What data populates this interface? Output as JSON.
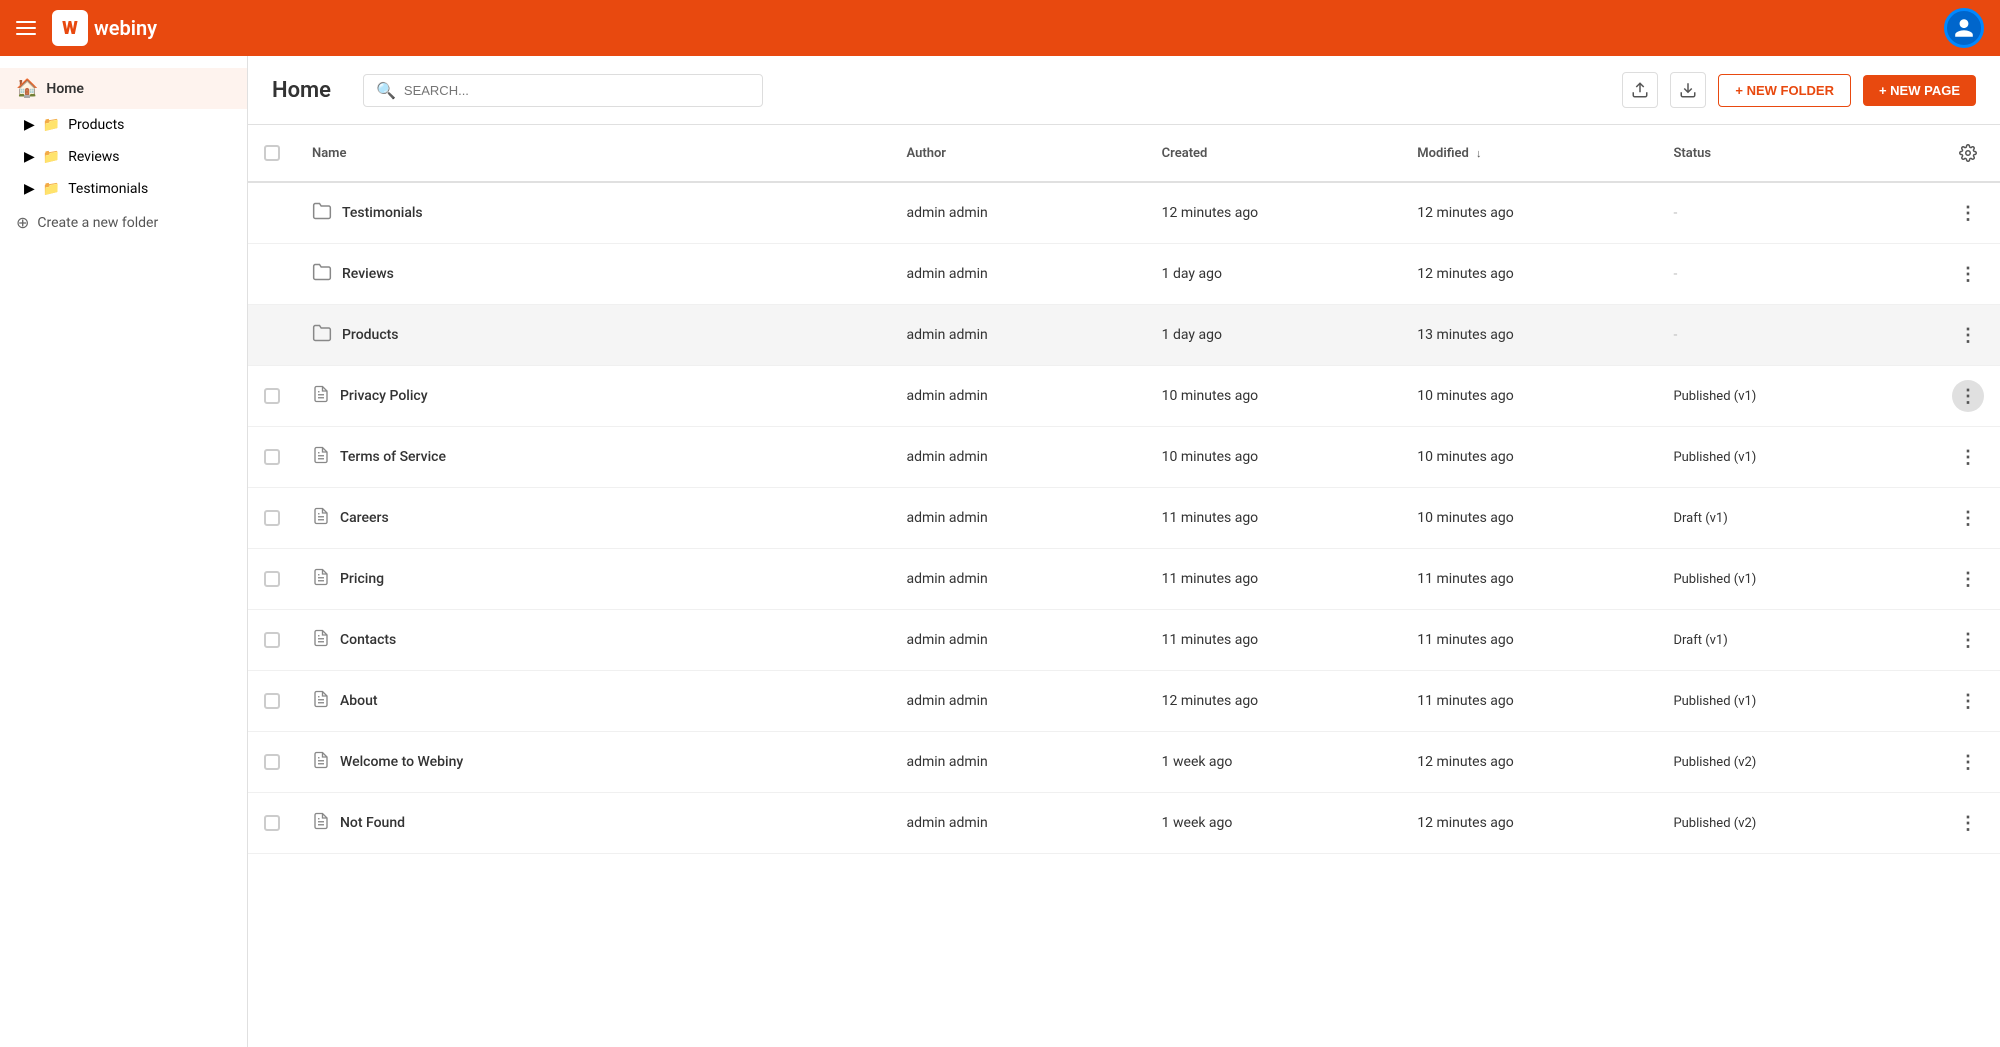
{
  "topNav": {
    "logoLetter": "W",
    "logoText": "webiny"
  },
  "sidebar": {
    "homeLabel": "Home",
    "items": [
      {
        "id": "products",
        "label": "Products",
        "type": "folder"
      },
      {
        "id": "reviews",
        "label": "Reviews",
        "type": "folder"
      },
      {
        "id": "testimonials",
        "label": "Testimonials",
        "type": "folder"
      }
    ],
    "createFolderLabel": "Create a new folder"
  },
  "pageHeader": {
    "title": "Home",
    "searchPlaceholder": "SEARCH...",
    "newFolderLabel": "+ NEW FOLDER",
    "newPageLabel": "+ NEW PAGE"
  },
  "table": {
    "columns": {
      "name": "Name",
      "author": "Author",
      "created": "Created",
      "modified": "Modified",
      "status": "Status"
    },
    "rows": [
      {
        "id": 1,
        "type": "folder",
        "name": "Testimonials",
        "author": "admin admin",
        "created": "12 minutes ago",
        "modified": "12 minutes ago",
        "status": "-",
        "highlighted": false
      },
      {
        "id": 2,
        "type": "folder",
        "name": "Reviews",
        "author": "admin admin",
        "created": "1 day ago",
        "modified": "12 minutes ago",
        "status": "-",
        "highlighted": false
      },
      {
        "id": 3,
        "type": "folder",
        "name": "Products",
        "author": "admin admin",
        "created": "1 day ago",
        "modified": "13 minutes ago",
        "status": "-",
        "highlighted": true
      },
      {
        "id": 4,
        "type": "page",
        "name": "Privacy Policy",
        "author": "admin admin",
        "created": "10 minutes ago",
        "modified": "10 minutes ago",
        "status": "Published (v1)",
        "highlighted": false
      },
      {
        "id": 5,
        "type": "page",
        "name": "Terms of Service",
        "author": "admin admin",
        "created": "10 minutes ago",
        "modified": "10 minutes ago",
        "status": "Published (v1)",
        "highlighted": false
      },
      {
        "id": 6,
        "type": "page",
        "name": "Careers",
        "author": "admin admin",
        "created": "11 minutes ago",
        "modified": "10 minutes ago",
        "status": "Draft (v1)",
        "highlighted": false
      },
      {
        "id": 7,
        "type": "page",
        "name": "Pricing",
        "author": "admin admin",
        "created": "11 minutes ago",
        "modified": "11 minutes ago",
        "status": "Published (v1)",
        "highlighted": false
      },
      {
        "id": 8,
        "type": "page",
        "name": "Contacts",
        "author": "admin admin",
        "created": "11 minutes ago",
        "modified": "11 minutes ago",
        "status": "Draft (v1)",
        "highlighted": false
      },
      {
        "id": 9,
        "type": "page",
        "name": "About",
        "author": "admin admin",
        "created": "12 minutes ago",
        "modified": "11 minutes ago",
        "status": "Published (v1)",
        "highlighted": false
      },
      {
        "id": 10,
        "type": "page",
        "name": "Welcome to Webiny",
        "author": "admin admin",
        "created": "1 week ago",
        "modified": "12 minutes ago",
        "status": "Published (v2)",
        "highlighted": false
      },
      {
        "id": 11,
        "type": "page",
        "name": "Not Found",
        "author": "admin admin",
        "created": "1 week ago",
        "modified": "12 minutes ago",
        "status": "Published (v2)",
        "highlighted": false
      }
    ]
  }
}
